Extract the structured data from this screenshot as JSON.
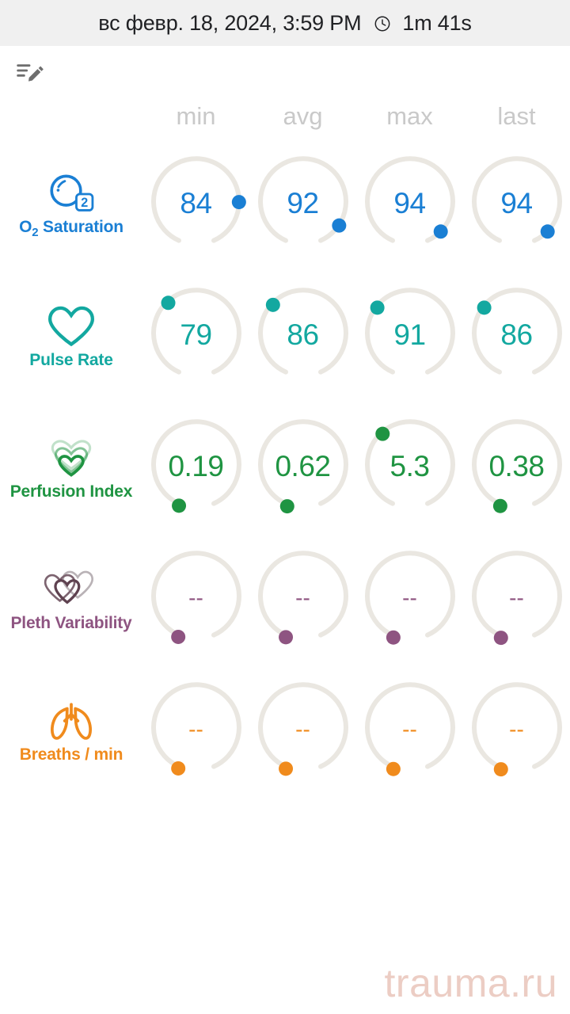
{
  "header": {
    "date_time": "вс февр. 18, 2024, 3:59 PM",
    "clock_icon": "clock-icon",
    "duration": "1m 41s",
    "background_color": "#f0f0f0",
    "text_color": "#202124"
  },
  "toolbar": {
    "edit_note_icon": "edit-note-icon",
    "icon_color": "#6e6e6e"
  },
  "columns": [
    {
      "key": "min",
      "label": "min"
    },
    {
      "key": "avg",
      "label": "avg"
    },
    {
      "key": "max",
      "label": "max"
    },
    {
      "key": "last",
      "label": "last"
    }
  ],
  "column_header_color": "#c9c9c9",
  "gauge_track_color": "#eae7e1",
  "metrics": [
    {
      "name": "O2 Saturation",
      "name_prefix": "O",
      "name_subscript": "2",
      "name_suffix": " Saturation",
      "icon": "o2-bubble-icon",
      "color": "#1a7fd4",
      "values": [
        "84",
        "92",
        "94",
        "94"
      ],
      "marker_angles": [
        92,
        118,
        130,
        130
      ]
    },
    {
      "name": "Pulse Rate",
      "icon": "heart-outline-icon",
      "color": "#13a8a0",
      "values": [
        "79",
        "86",
        "91",
        "86"
      ],
      "marker_angles": [
        311,
        315,
        320,
        320
      ]
    },
    {
      "name": "Perfusion Index",
      "icon": "triple-heart-icon",
      "color": "#1f9442",
      "values": [
        "0.19",
        "0.62",
        "5.3",
        "0.38"
      ],
      "marker_angles": [
        246,
        248,
        310,
        247
      ]
    },
    {
      "name": "Pleth Variability",
      "icon": "overlapping-hearts-icon",
      "color": "#8e5481",
      "values": [
        "--",
        "--",
        "--",
        "--"
      ],
      "marker_angles": [
        245,
        246,
        247,
        248
      ]
    },
    {
      "name": "Breaths / min",
      "icon": "lungs-icon",
      "color": "#f08b1d",
      "values": [
        "--",
        "--",
        "--",
        "--"
      ],
      "marker_angles": [
        245,
        246,
        247,
        248
      ]
    }
  ],
  "watermark": {
    "text": "trauma.ru",
    "color": "#eccdc4"
  }
}
